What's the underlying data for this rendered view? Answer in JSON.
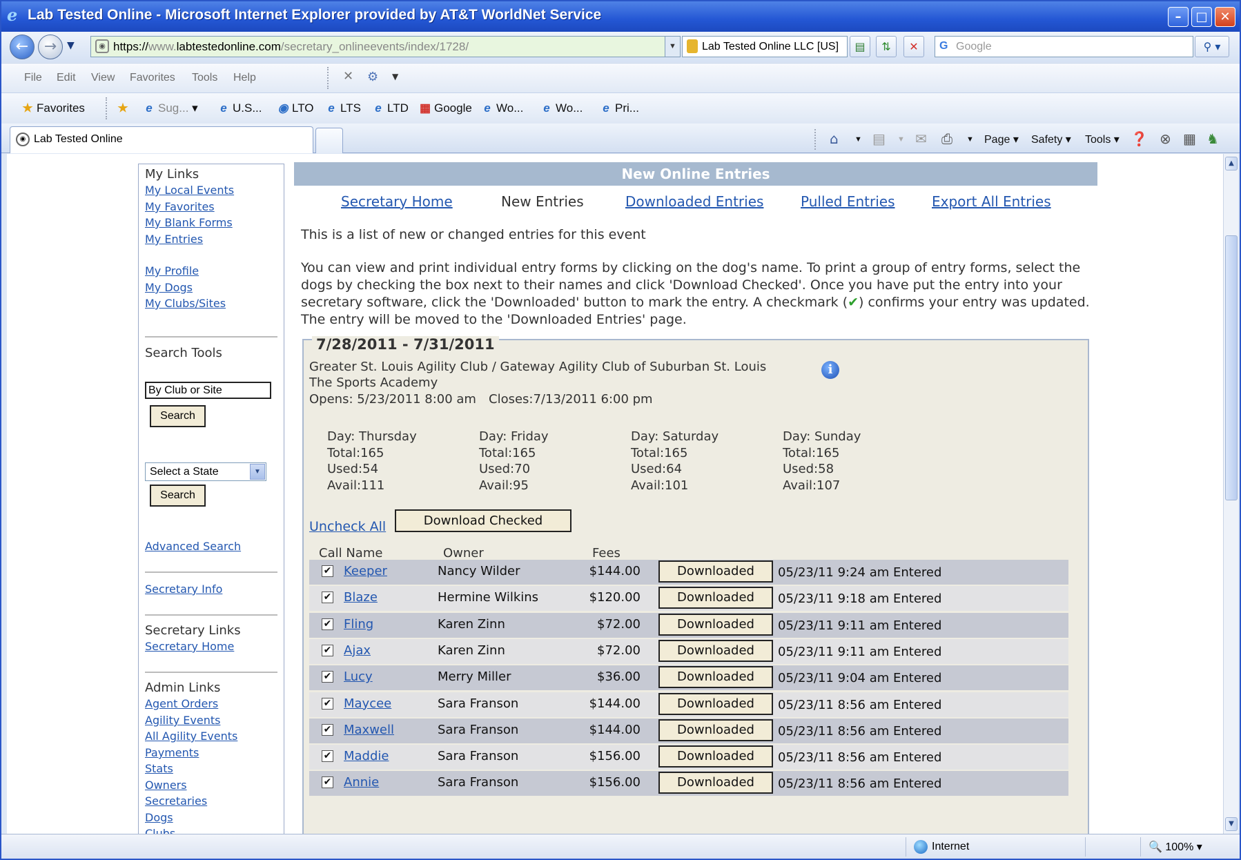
{
  "window": {
    "title": "Lab Tested Online - Microsoft Internet Explorer provided by AT&T WorldNet Service"
  },
  "address": {
    "proto": "https://",
    "host_prefix": "www.",
    "domain": "labtestedonline.com",
    "path": "/secretary_onlineevents/index/1728/"
  },
  "security": {
    "identity": "Lab Tested Online LLC [US]"
  },
  "search": {
    "placeholder": "Google"
  },
  "menu": [
    "File",
    "Edit",
    "View",
    "Favorites",
    "Tools",
    "Help"
  ],
  "favorites": {
    "label": "Favorites",
    "items": [
      "Sug...",
      "U.S...",
      "LTO",
      "LTS",
      "LTD",
      "Google",
      "Wo...",
      "Wo...",
      "Pri..."
    ]
  },
  "tab": {
    "title": "Lab Tested Online"
  },
  "commandbar": {
    "page": "Page",
    "safety": "Safety",
    "tools": "Tools"
  },
  "status": {
    "zone": "Internet",
    "zoom": "100%"
  },
  "sidebar": {
    "my_links_title": "My Links",
    "my_links": [
      "My Local Events",
      "My Favorites",
      "My Blank Forms",
      "My Entries"
    ],
    "profile_links": [
      "My Profile",
      "My Dogs",
      "My Clubs/Sites"
    ],
    "search_tools_title": "Search Tools",
    "club_input_value": "By Club or Site",
    "search_label": "Search",
    "state_select": "Select a State",
    "advanced_search": "Advanced Search",
    "secretary_info": "Secretary Info",
    "secretary_links_title": "Secretary Links",
    "secretary_home": "Secretary Home",
    "admin_links_title": "Admin Links",
    "admin_links": [
      "Agent Orders",
      "Agility Events",
      "All Agility Events",
      "Payments",
      "Stats",
      "Owners",
      "Secretaries",
      "Dogs",
      "Clubs"
    ]
  },
  "main": {
    "heading": "New Online Entries",
    "nav": [
      "Secretary Home",
      "New Entries",
      "Downloaded Entries",
      "Pulled Entries",
      "Export All Entries"
    ],
    "intro1": "This is a list of new or changed entries for this event",
    "intro2_a": "You can view and print individual entry forms by clicking on the dog's name. To print a group of entry forms, select the dogs by checking the box next to their names and click 'Download Checked'. Once you have put the entry into your secretary software, click the 'Downloaded' button to mark the entry. A checkmark (",
    "intro2_check": "✔",
    "intro2_b": ") confirms your entry was updated. The entry will be moved to the 'Downloaded Entries' page."
  },
  "event": {
    "dates": "7/28/2011 - 7/31/2011",
    "clubs": "Greater St. Louis Agility Club / Gateway Agility Club of Suburban St. Louis",
    "venue": "The Sports Academy",
    "opens": "Opens: 5/23/2011 8:00 am",
    "closes": "Closes:7/13/2011 6:00 pm",
    "days": [
      {
        "day": "Day: Thursday",
        "total": "Total:165",
        "used": "Used:54",
        "avail": "Avail:111"
      },
      {
        "day": "Day: Friday",
        "total": "Total:165",
        "used": "Used:70",
        "avail": "Avail:95"
      },
      {
        "day": "Day: Saturday",
        "total": "Total:165",
        "used": "Used:64",
        "avail": "Avail:101"
      },
      {
        "day": "Day: Sunday",
        "total": "Total:165",
        "used": "Used:58",
        "avail": "Avail:107"
      }
    ],
    "uncheck_all": "Uncheck All",
    "download_checked": "Download Checked",
    "columns": {
      "call_name": "Call Name",
      "owner": "Owner",
      "fees": "Fees"
    },
    "downloaded_label": "Downloaded",
    "entries": [
      {
        "name": "Keeper",
        "owner": "Nancy Wilder",
        "fee": "$144.00",
        "status": "05/23/11 9:24 am Entered"
      },
      {
        "name": "Blaze",
        "owner": "Hermine Wilkins",
        "fee": "$120.00",
        "status": "05/23/11 9:18 am Entered"
      },
      {
        "name": "Fling",
        "owner": "Karen Zinn",
        "fee": "$72.00",
        "status": "05/23/11 9:11 am Entered"
      },
      {
        "name": "Ajax",
        "owner": "Karen Zinn",
        "fee": "$72.00",
        "status": "05/23/11 9:11 am Entered"
      },
      {
        "name": "Lucy",
        "owner": "Merry Miller",
        "fee": "$36.00",
        "status": "05/23/11 9:04 am Entered"
      },
      {
        "name": "Maycee",
        "owner": "Sara Franson",
        "fee": "$144.00",
        "status": "05/23/11 8:56 am Entered"
      },
      {
        "name": "Maxwell",
        "owner": "Sara Franson",
        "fee": "$144.00",
        "status": "05/23/11 8:56 am Entered"
      },
      {
        "name": "Maddie",
        "owner": "Sara Franson",
        "fee": "$156.00",
        "status": "05/23/11 8:56 am Entered"
      },
      {
        "name": "Annie",
        "owner": "Sara Franson",
        "fee": "$156.00",
        "status": "05/23/11 8:56 am Entered"
      }
    ]
  }
}
